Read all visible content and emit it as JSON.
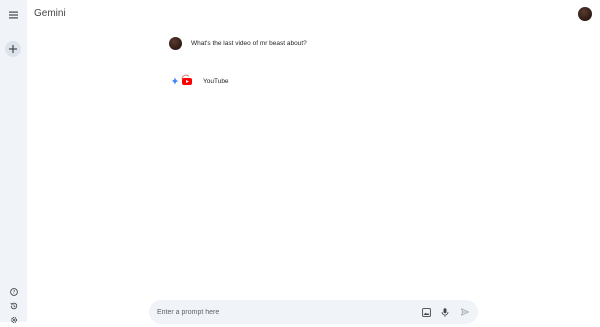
{
  "app": {
    "title": "Gemini"
  },
  "conversation": {
    "user_prompt": "What's the last video of mr beast about?",
    "response_source": "YouTube"
  },
  "prompt_bar": {
    "placeholder": "Enter a prompt here"
  },
  "icons": {
    "menu": "menu-icon",
    "new_chat": "plus-icon",
    "help": "help-icon",
    "activity": "history-icon",
    "settings": "gear-icon",
    "image": "image-icon",
    "mic": "mic-icon",
    "send": "send-icon",
    "gemini": "gemini-sparkle-icon",
    "youtube": "youtube-icon"
  },
  "colors": {
    "rail_bg": "#f0f4f9",
    "prompt_bg": "#f0f4f9",
    "youtube_red": "#ff0000",
    "gemini_blue": "#4285f4"
  }
}
